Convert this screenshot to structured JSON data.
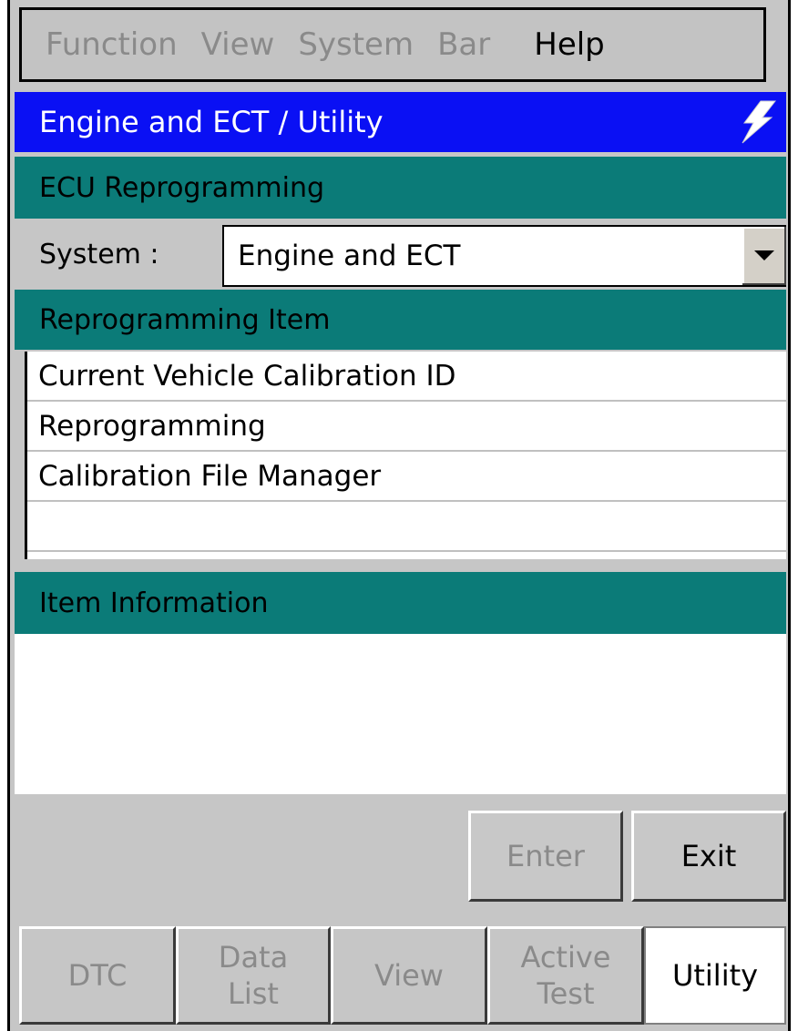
{
  "menubar": {
    "items": [
      "Function",
      "View",
      "System",
      "Bar",
      "Help"
    ]
  },
  "titlebar": {
    "title": "Engine and ECT / Utility"
  },
  "sections": {
    "ecu": "ECU Reprogramming",
    "item": "Reprogramming Item",
    "info": "Item Information"
  },
  "system": {
    "label": "System :",
    "value": "Engine and ECT"
  },
  "items": [
    "Current Vehicle Calibration ID",
    "Reprogramming",
    "Calibration File Manager"
  ],
  "buttons": {
    "enter": "Enter",
    "exit": "Exit"
  },
  "tabs": [
    "DTC",
    "Data\nList",
    "View",
    "Active\nTest",
    "Utility"
  ],
  "colors": {
    "title_bar": "#0a10f4",
    "section_header": "#0b7b78",
    "disabled_text": "#8a8a8a"
  }
}
